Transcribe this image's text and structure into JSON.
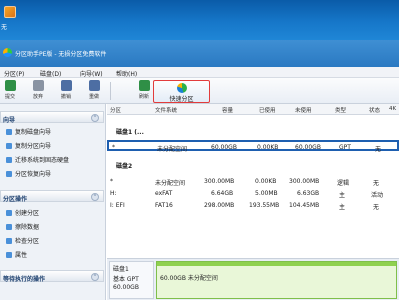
{
  "desktop": {
    "icon_label": "无"
  },
  "window": {
    "title": "分区助手PE版 - 无损分区免费软件"
  },
  "menu": [
    "分区(P)",
    "磁盘(D)",
    "向导(W)",
    "帮助(H)"
  ],
  "toolbar": {
    "tools": [
      {
        "label": "提交",
        "color": "#2f8f46"
      },
      {
        "label": "放弃",
        "color": "#8a94a3"
      },
      {
        "label": "撤销",
        "color": "#4d6ea3"
      },
      {
        "label": "重做",
        "color": "#4d6ea3"
      },
      {
        "label": "刷新",
        "color": "#2f8f46"
      }
    ],
    "quick_partition": "快速分区"
  },
  "left_panel": {
    "wizard_title": "向导",
    "wizard_items": [
      "复制磁盘向导",
      "复制分区向导",
      "迁移系统到固态硬盘",
      "分区恢复向导"
    ],
    "ops_title": "分区操作",
    "ops_items": [
      "创建分区",
      "擦除数据",
      "检查分区",
      "属性"
    ],
    "pending_title": "等待执行的操作"
  },
  "table": {
    "columns": [
      "分区",
      "文件系统",
      "容量",
      "已使用",
      "未使用",
      "类型",
      "状态",
      "4K"
    ],
    "disk1_label": "磁盘1 (...",
    "disk1_rows": [
      {
        "partition": "*",
        "fs": "未分配空间",
        "capacity": "60.00GB",
        "used": "0.00KB",
        "free": "60.00GB",
        "type": "GPT",
        "status": "无"
      }
    ],
    "disk2_label": "磁盘2",
    "disk2_rows": [
      {
        "partition": "*",
        "fs": "未分配空间",
        "capacity": "300.00MB",
        "used": "0.00KB",
        "free": "300.00MB",
        "type": "逻辑",
        "status": "无"
      },
      {
        "partition": "H:",
        "fs": "exFAT",
        "capacity": "6.64GB",
        "used": "5.00MB",
        "free": "6.63GB",
        "type": "主",
        "status": "活动"
      },
      {
        "partition": "I: EFI",
        "fs": "FAT16",
        "capacity": "298.00MB",
        "used": "193.55MB",
        "free": "104.45MB",
        "type": "主",
        "status": "无"
      }
    ]
  },
  "diskmap": {
    "disk_name": "磁盘1",
    "disk_type": "基本 GPT",
    "disk_size": "60.00GB",
    "bar_text": "60.00GB 未分配空间"
  }
}
